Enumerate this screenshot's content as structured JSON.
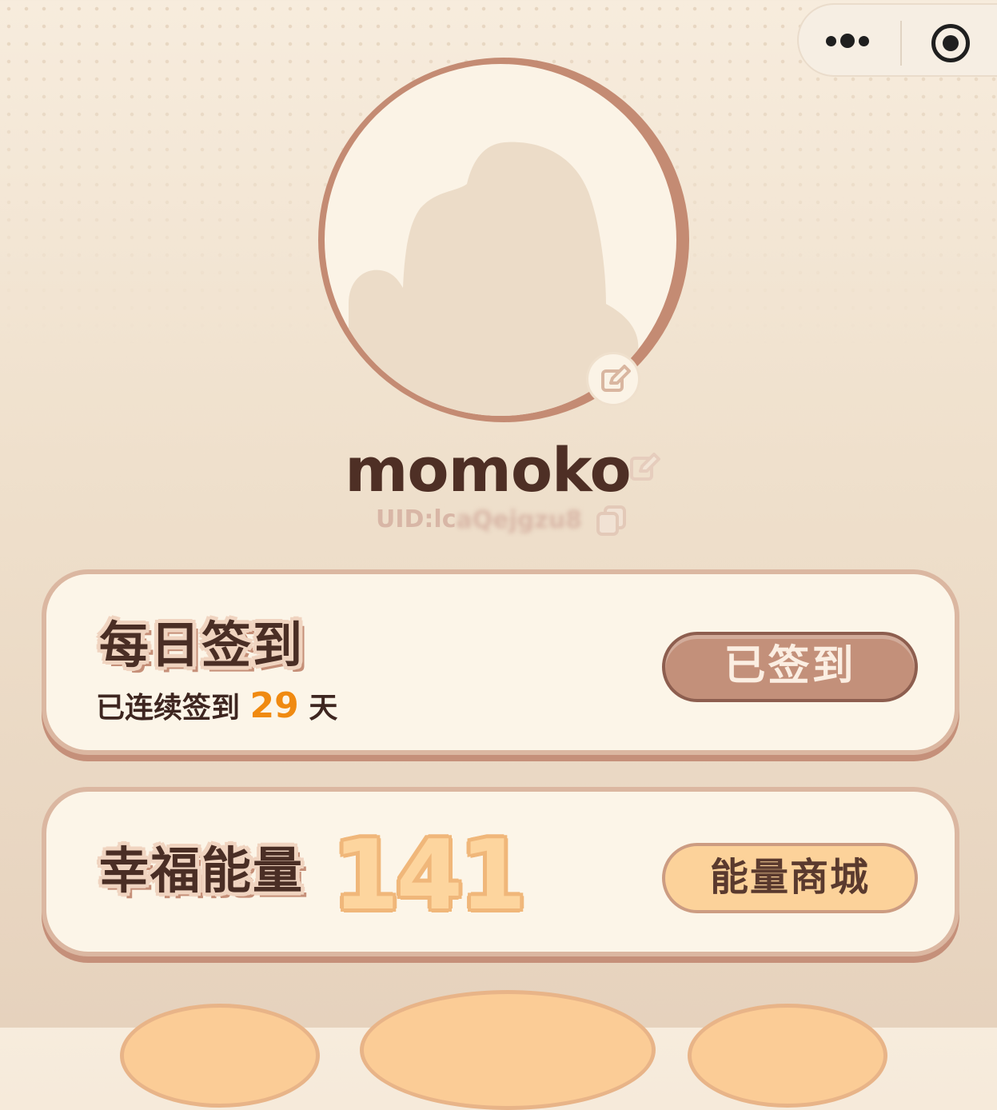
{
  "capsule": {
    "more_icon": "more-dots-icon",
    "close_icon": "target-circle-icon"
  },
  "profile": {
    "name": "momoko",
    "uid": "UID:lc",
    "uid_masked": "aQejgzu8",
    "edit_icon": "pencil-edit-icon",
    "copy_icon": "copy-icon"
  },
  "sign_card": {
    "title": "每日签到",
    "streak_prefix": "已连续签到 ",
    "streak_days": "29",
    "streak_suffix": " 天",
    "button_label": "已签到"
  },
  "energy_card": {
    "title": "幸福能量",
    "value": "141",
    "button_label": "能量商城"
  },
  "colors": {
    "accent_orange": "#f08a11",
    "card_border": "#dbb7a1",
    "signed_button": "#c3907a",
    "shop_button": "#fcd29a"
  }
}
